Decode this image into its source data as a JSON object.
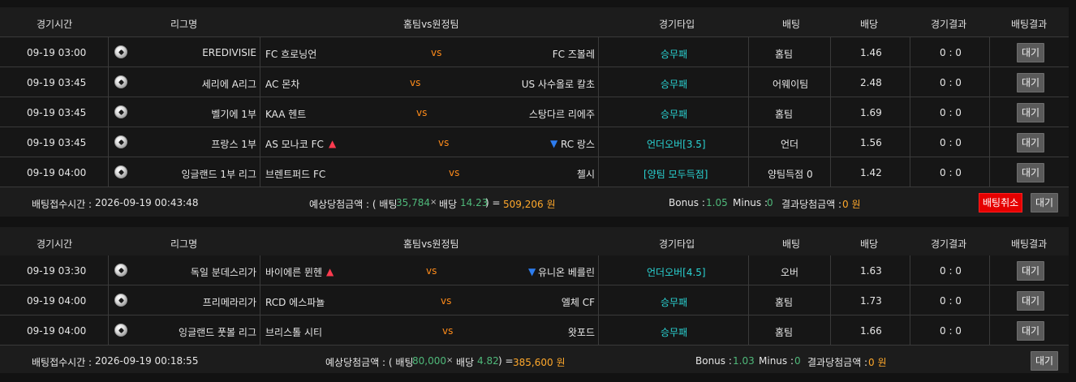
{
  "headers": [
    "경기시간",
    "리그명",
    "홈팀vs원정팀",
    "경기타입",
    "배팅",
    "배당",
    "경기결과",
    "배팅결과"
  ],
  "vs_label": "vs",
  "slip1": {
    "rows": [
      {
        "time": "09-19 03:00",
        "league": "EREDIVISIE",
        "home": "FC 흐로닝언",
        "away": "FC 즈볼레",
        "type": "승무패",
        "bet": "홈팀",
        "odds": "1.46",
        "result": "0 : 0",
        "status": "대기"
      },
      {
        "time": "09-19 03:45",
        "league": "세리에 A리그",
        "home": "AC 몬차",
        "away": "US 사수올로 칼초",
        "type": "승무패",
        "bet": "어웨이팀",
        "odds": "2.48",
        "result": "0 : 0",
        "status": "대기"
      },
      {
        "time": "09-19 03:45",
        "league": "벨기에 1부",
        "home": "KAA 헨트",
        "away": "스탕다르 리에주",
        "type": "승무패",
        "bet": "홈팀",
        "odds": "1.69",
        "result": "0 : 0",
        "status": "대기"
      },
      {
        "time": "09-19 03:45",
        "league": "프랑스 1부",
        "home": "AS 모나코 FC",
        "away": "RC 랑스",
        "type": "언더오버[3.5]",
        "bet": "언더",
        "odds": "1.56",
        "result": "0 : 0",
        "status": "대기"
      },
      {
        "time": "09-19 04:00",
        "league": "잉글랜드 1부 리그",
        "home": "브렌트퍼드 FC",
        "away": "첼시",
        "type": "[양팀 모두득점]",
        "bet": "양팀득점 0",
        "odds": "1.42",
        "result": "0 : 0",
        "status": "대기"
      }
    ],
    "footer": {
      "time_label": "배팅접수시간 :",
      "time_value": "2026-09-19 00:43:48",
      "expected_label": "예상당첨금액 : ( 배팅",
      "bet_amount": "35,784",
      "times": "×",
      "odds_label": "배당",
      "total_odds": "14.23",
      "eq": ") =",
      "payout": "509,206 원",
      "bonus_label": "Bonus :",
      "bonus": "1.05",
      "minus_label": "Minus :",
      "minus": "0",
      "result_label": "결과당첨금액 :",
      "result_amount": "0 원",
      "cancel_label": "배팅취소",
      "status": "대기"
    }
  },
  "slip2": {
    "rows": [
      {
        "time": "09-19 03:30",
        "league": "독일 분데스리가",
        "home": "바이에른 뮌헨",
        "away": "유니온 베를린",
        "type": "언더오버[4.5]",
        "bet": "오버",
        "odds": "1.63",
        "result": "0 : 0",
        "status": "대기"
      },
      {
        "time": "09-19 04:00",
        "league": "프리메라리가",
        "home": "RCD 에스파뇰",
        "away": "엘체 CF",
        "type": "승무패",
        "bet": "홈팀",
        "odds": "1.73",
        "result": "0 : 0",
        "status": "대기"
      },
      {
        "time": "09-19 04:00",
        "league": "잉글랜드 풋볼 리그",
        "home": "브리스톨 시티",
        "away": "왓포드",
        "type": "승무패",
        "bet": "홈팀",
        "odds": "1.66",
        "result": "0 : 0",
        "status": "대기"
      }
    ],
    "footer": {
      "time_label": "배팅접수시간 :",
      "time_value": "2026-09-19 00:18:55",
      "expected_label": "예상당첨금액 : ( 배팅",
      "bet_amount": "80,000",
      "times": "×",
      "odds_label": "배당",
      "total_odds": "4.82",
      "eq": ") =",
      "payout": "385,600 원",
      "bonus_label": "Bonus :",
      "bonus": "1.03",
      "minus_label": "Minus :",
      "minus": "0",
      "result_label": "결과당첨금액 :",
      "result_amount": "0 원",
      "status": "대기"
    }
  },
  "colors": {
    "vs": "#ff8c1a",
    "type": "#2ad3d3",
    "up": "#ff3b4f",
    "down": "#2d7df0",
    "cancel": "#e60000"
  }
}
